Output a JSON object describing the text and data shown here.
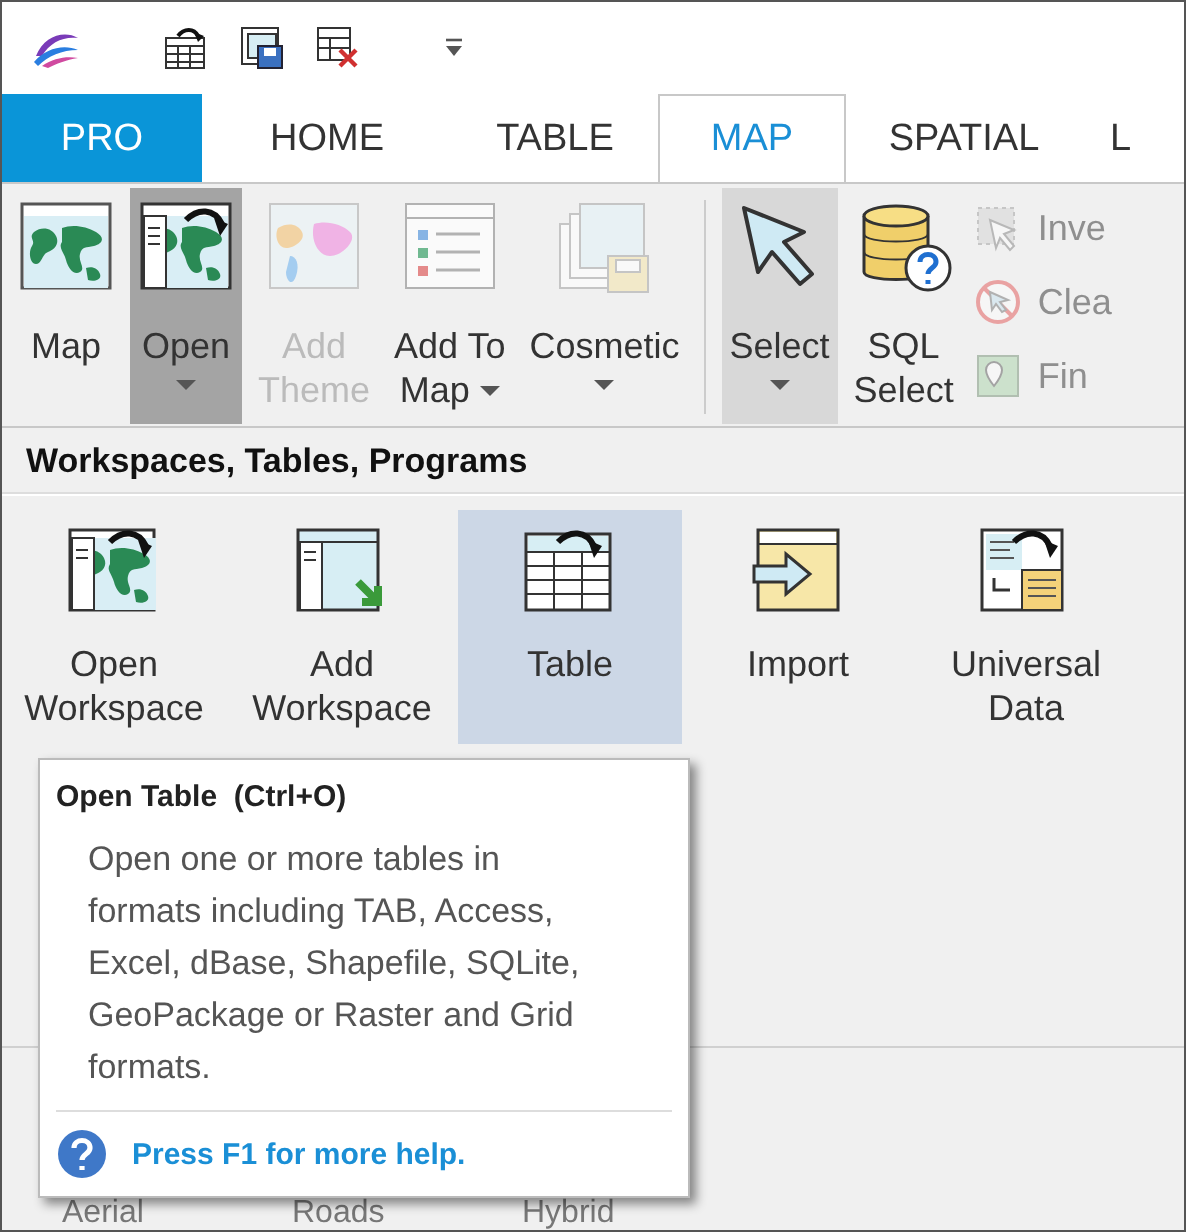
{
  "tabs": [
    {
      "label": "PRO",
      "kind": "app",
      "selected": false
    },
    {
      "label": "HOME",
      "kind": "tab",
      "selected": false
    },
    {
      "label": "TABLE",
      "kind": "tab",
      "selected": false
    },
    {
      "label": "MAP",
      "kind": "tab",
      "selected": true
    },
    {
      "label": "SPATIAL",
      "kind": "tab",
      "selected": false
    },
    {
      "label": "L",
      "kind": "tab",
      "selected": false
    }
  ],
  "ribbon": {
    "large_buttons": [
      {
        "lines": [
          "Map"
        ],
        "disabled": false,
        "pressed": false,
        "hovered": false,
        "dropdown": false
      },
      {
        "lines": [
          "Open"
        ],
        "disabled": false,
        "pressed": true,
        "hovered": false,
        "dropdown": true
      },
      {
        "lines": [
          "Add",
          "Theme"
        ],
        "disabled": true,
        "pressed": false,
        "hovered": false,
        "dropdown": false
      },
      {
        "lines": [
          "Add To",
          "Map"
        ],
        "disabled": false,
        "pressed": false,
        "hovered": false,
        "dropdown": true
      },
      {
        "lines": [
          "Cosmetic"
        ],
        "disabled": false,
        "pressed": false,
        "hovered": false,
        "dropdown": true
      },
      {
        "lines": [
          "Select"
        ],
        "disabled": false,
        "pressed": false,
        "hovered": true,
        "dropdown": true
      },
      {
        "lines": [
          "SQL",
          "Select"
        ],
        "disabled": false,
        "pressed": false,
        "hovered": false,
        "dropdown": false
      }
    ],
    "small_buttons": [
      {
        "label": "Inve",
        "disabled": true
      },
      {
        "label": "Clea",
        "disabled": true
      },
      {
        "label": "Fin",
        "disabled": true
      }
    ]
  },
  "panel": {
    "title": "Workspaces, Tables, Programs",
    "items": [
      {
        "lines": [
          "Open",
          "Workspace"
        ],
        "selected": false
      },
      {
        "lines": [
          "Add",
          "Workspace"
        ],
        "selected": false
      },
      {
        "lines": [
          "Table"
        ],
        "selected": true
      },
      {
        "lines": [
          "Import"
        ],
        "selected": false
      },
      {
        "lines": [
          "Universal",
          "Data"
        ],
        "selected": false
      }
    ],
    "gallery": [
      "Aerial",
      "Roads",
      "Hybrid"
    ]
  },
  "tooltip": {
    "title": "Open Table  (Ctrl+O)",
    "body": "Open one or more tables in formats including TAB, Access, Excel, dBase, Shapefile, SQLite, GeoPackage or Raster and Grid formats.",
    "help": "Press F1 for more help."
  }
}
